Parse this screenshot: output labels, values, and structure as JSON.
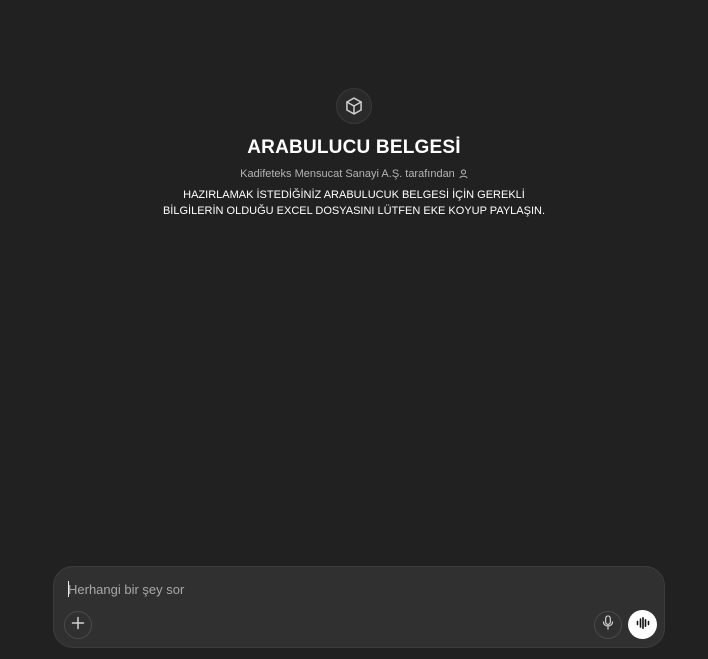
{
  "gpt": {
    "icon": "cube-icon",
    "title": "ARABULUCU BELGESİ",
    "byline": "Kadifeteks Mensucat Sanayi A.Ş. tarafından",
    "byline_icon": "person-icon",
    "description": "HAZIRLAMAK İSTEDİĞİNİZ ARABULUCUK BELGESİ İÇİN GEREKLİ BİLGİLERİN OLDUĞU EXCEL DOSYASINI LÜTFEN EKE KOYUP PAYLAŞIN."
  },
  "composer": {
    "placeholder": "Herhangi bir şey sor",
    "value": "",
    "add_icon": "plus-icon",
    "mic_icon": "microphone-icon",
    "voice_icon": "voice-mode-icon"
  }
}
